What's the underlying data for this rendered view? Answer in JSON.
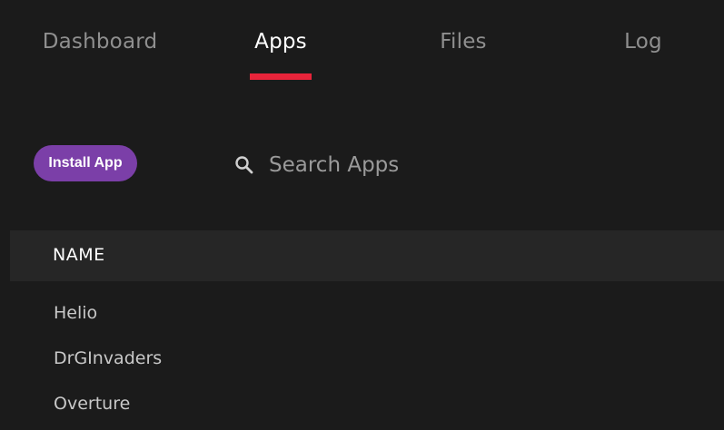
{
  "tabs": [
    {
      "label": "Dashboard"
    },
    {
      "label": "Apps"
    },
    {
      "label": "Files"
    },
    {
      "label": "Log"
    }
  ],
  "active_tab": "Apps",
  "toolbar": {
    "install_label": "Install App",
    "search_placeholder": "Search Apps",
    "search_value": ""
  },
  "table": {
    "column_name": "NAME",
    "rows": [
      {
        "name": "Helio"
      },
      {
        "name": "DrGInvaders"
      },
      {
        "name": "Overture"
      }
    ]
  },
  "icons": {
    "search": "search-icon"
  },
  "colors": {
    "background": "#1b1b1b",
    "accent_underline": "#e8243a",
    "install_button": "#7b3fa8",
    "header_row": "#262626"
  }
}
